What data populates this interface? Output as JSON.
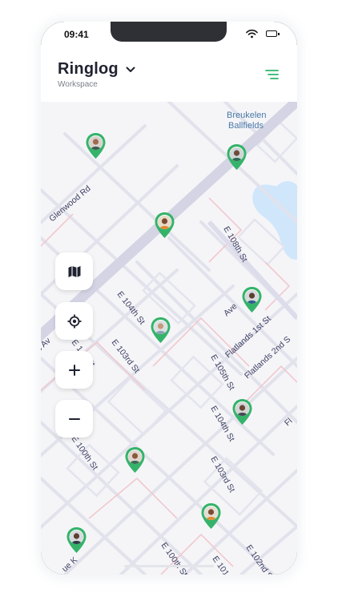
{
  "status": {
    "time": "09:41"
  },
  "header": {
    "title": "Ringlog",
    "subtitle": "Workspace"
  },
  "map": {
    "labels": {
      "park_line1": "Breukelen",
      "park_line2": "Ballfields",
      "glenwood": "Glenwood Rd",
      "e108": "E 108th St",
      "e104_a": "E 104th St",
      "e103_a": "E 103rd St",
      "e102_a": "E 1..d St",
      "e105": "E 105th St",
      "flatlands1": "Flatlands 1st St",
      "flatlands2": "Flatlands 2nd S",
      "ave": "Ave",
      "e104_b": "E 104th St",
      "e103_b": "E 103rd St",
      "e100": "E 100th St",
      "e100b": "E 100th St",
      "e101": "E 101",
      "e102_b": "E 102nd S",
      "s_av": "s Av",
      "ue_k": "ue K",
      "fl": "Fl"
    }
  },
  "controls": {
    "map_layers": "map-icon",
    "locate": "crosshair-icon",
    "zoom_in": "+",
    "zoom_out": "−"
  },
  "colors": {
    "pin_green": "#35b36a",
    "park_label": "#4a79a7",
    "water": "#cfe6fb",
    "accent": "#2fb569"
  }
}
